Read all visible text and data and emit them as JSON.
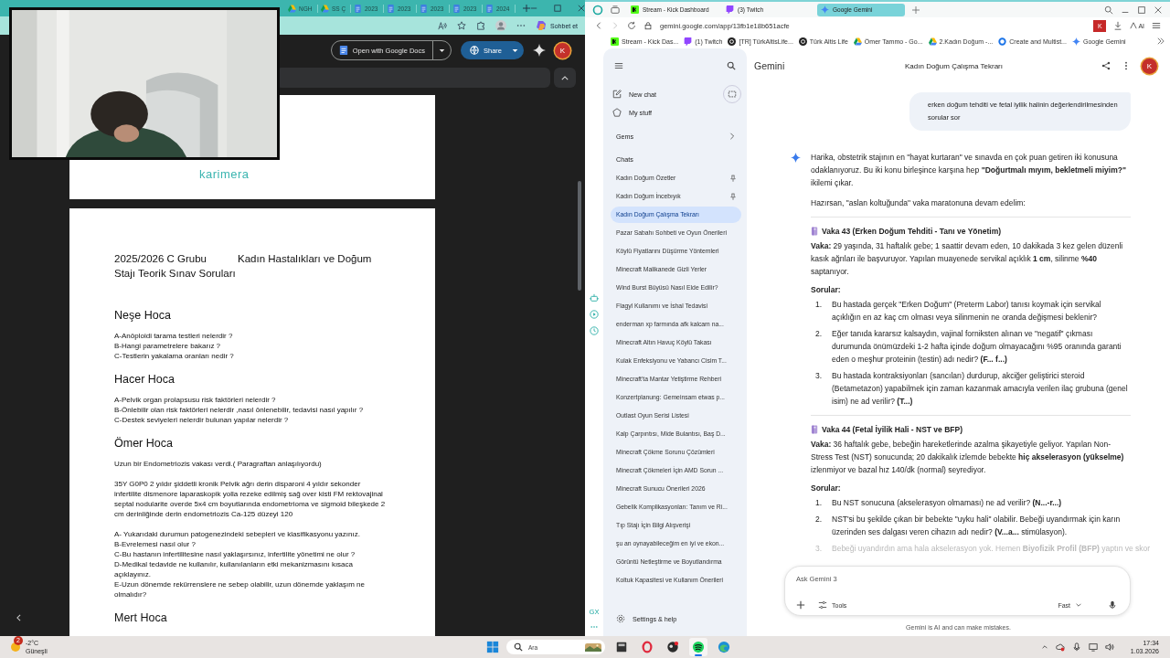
{
  "left_browser": {
    "tabs": [
      {
        "label": "NGH",
        "kind": "drive"
      },
      {
        "label": "SS Ç",
        "kind": "drive"
      },
      {
        "label": "2023",
        "kind": "doc"
      },
      {
        "label": "2023",
        "kind": "doc"
      },
      {
        "label": "2023",
        "kind": "doc"
      },
      {
        "label": "2023",
        "kind": "doc"
      },
      {
        "label": "2024",
        "kind": "doc"
      }
    ],
    "copilot": "Sohbet et"
  },
  "viewer": {
    "open_with": "Open with Google Docs",
    "share": "Share",
    "avatar": "K"
  },
  "document": {
    "cover_text": "karimera",
    "title": [
      "2025/2026 C Grubu",
      "Kadın Hastalıkları ve Doğum",
      "Stajı Teorik Sınav Soruları"
    ],
    "sections": [
      {
        "heading": "Neşe Hoca",
        "blocks": [
          [
            "A-Anöploidi tarama testleri nelerdir ?",
            "B-Hangi parametrelere bakarız ?",
            "C-Testlerin yakalama oranları nedir ?"
          ]
        ]
      },
      {
        "heading": "Hacer Hoca",
        "blocks": [
          [
            "A-Pelvik organ prolapsusu risk faktörleri nelerdir ?",
            "B-Önlebilir olan risk faktörleri nelerdir ,nasıl önlenebilir, tedavisi nasıl yapılır ?",
            "C-Destek seviyeleri nelerdir bulunan yapılar nelerdir ?"
          ]
        ]
      },
      {
        "heading": "Ömer Hoca",
        "blocks": [
          [
            "Uzun bir Endometriozis vakası verdi.( Paragraftan anlaşılıyordu)"
          ],
          [
            "35Y G0P0 2 yıldır şiddetli kronik Pelvik ağrı derin disparoni 4 yıldır sekonder infertilite dismenore laparaskopik yolla rezeke edilmiş sağ over kisti FM rektovajinal septal nodularite overde 5x4 cm boyutlarında endometrioma ve sigmoid bileşkede 2 cm derinliğinde derin endometriozis Ca-125 düzeyi 120"
          ],
          [
            "A- Yukarıdaki durumun patogenezindeki sebepleri ve klasifikasyonu yazınız.",
            "B-Evrelemesi nasıl olur ?",
            "C-Bu hastanın infertilitesine nasıl yaklaşırsınız, infertilite yönetimi ne olur ?",
            "D-Medikal tedavide ne kullanılır, kullanılanların etki mekanizmasını kısaca açıklayınız.",
            "E-Uzun dönemde rekürrenslere ne  sebep olabilir, uzun dönemde yaklaşım ne olmalıdır?"
          ]
        ]
      },
      {
        "heading": "Mert Hoca"
      }
    ]
  },
  "right_browser": {
    "tabs": [
      {
        "label": "Stream - Kick Dashboard",
        "kind": "kick",
        "selected": false
      },
      {
        "label": "(3) Twitch",
        "kind": "twitch",
        "selected": false
      },
      {
        "label": "Google Gemini",
        "kind": "gemini",
        "selected": true
      }
    ],
    "url": "gemini.google.com/app/13fb1e18b651acfe",
    "ext_avatar": "K",
    "ai_label": "AI",
    "bookmarks": [
      {
        "label": "Stream - Kick Das...",
        "kind": "kick"
      },
      {
        "label": "(1) Twitch",
        "kind": "twitch"
      },
      {
        "label": "[TR] TürkAltisLife...",
        "kind": "dark"
      },
      {
        "label": "Türk Altis Life",
        "kind": "dark"
      },
      {
        "label": "Ömer Tammo - Go...",
        "kind": "drive"
      },
      {
        "label": "2.Kadın Doğum -...",
        "kind": "drive"
      },
      {
        "label": "Create and Multist...",
        "kind": "ring"
      },
      {
        "label": "Google Gemini",
        "kind": "gemini"
      }
    ],
    "rail_label": "GX"
  },
  "gemini_sidebar": {
    "nav": [
      {
        "label": "New chat",
        "kind": "new"
      },
      {
        "label": "My stuff",
        "kind": "stuff"
      }
    ],
    "gems": "Gems",
    "chats_label": "Chats",
    "chats": [
      {
        "label": "Kadın Doğum Özetler",
        "pinned": true,
        "selected": false
      },
      {
        "label": "Kadın Doğum İncebıyık",
        "pinned": true,
        "selected": false
      },
      {
        "label": "Kadın Doğum Çalışma Tekrarı",
        "pinned": false,
        "selected": true
      },
      {
        "label": "Pazar Sabahı Sohbeti ve Oyun Önerileri",
        "pinned": false,
        "selected": false
      },
      {
        "label": "Köylü Fiyatlarını Düşürme Yöntemleri",
        "pinned": false,
        "selected": false
      },
      {
        "label": "Minecraft Malikanede Gizli Yerler",
        "pinned": false,
        "selected": false
      },
      {
        "label": "Wind Burst Büyüsü Nasıl Elde Edilir?",
        "pinned": false,
        "selected": false
      },
      {
        "label": "Flagyl Kullanımı ve İshal Tedavisi",
        "pinned": false,
        "selected": false
      },
      {
        "label": "enderman xp farmında afk kalcam na...",
        "pinned": false,
        "selected": false
      },
      {
        "label": "Minecraft Altın Havuç Köylü Takası",
        "pinned": false,
        "selected": false
      },
      {
        "label": "Kulak Enfeksiyonu ve Yabancı Cisim T...",
        "pinned": false,
        "selected": false
      },
      {
        "label": "Minecraft'ta Mantar Yetiştirme Rehberi",
        "pinned": false,
        "selected": false
      },
      {
        "label": "Konzertplanung: Gemeinsam etwas p...",
        "pinned": false,
        "selected": false
      },
      {
        "label": "Outlast Oyun Serisi Listesi",
        "pinned": false,
        "selected": false
      },
      {
        "label": "Kalp Çarpıntısı, Mide Bulantısı, Baş D...",
        "pinned": false,
        "selected": false
      },
      {
        "label": "Minecraft Çökme Sorunu Çözümleri",
        "pinned": false,
        "selected": false
      },
      {
        "label": "Minecraft Çökmeleri İçin AMD Sorun ...",
        "pinned": false,
        "selected": false
      },
      {
        "label": "Minecraft Sunucu Önerileri 2026",
        "pinned": false,
        "selected": false
      },
      {
        "label": "Gebelik Komplikasyonları: Tanım ve Ri...",
        "pinned": false,
        "selected": false
      },
      {
        "label": "Tıp Stajı İçin Bilgi Alışverişi",
        "pinned": false,
        "selected": false
      },
      {
        "label": "şu an oynayabileceğim en iyi ve ekon...",
        "pinned": false,
        "selected": false
      },
      {
        "label": "Görüntü Netleştirme ve Boyutlandırma",
        "pinned": false,
        "selected": false
      },
      {
        "label": "Koltuk Kapasitesi ve Kullanım Önerileri",
        "pinned": false,
        "selected": false
      }
    ],
    "settings": "Settings & help"
  },
  "gemini_main": {
    "brand": "Gemini",
    "title": "Kadın Doğum Çalışma Tekrarı",
    "avatar": "K",
    "user_message": "erken doğum tehditi ve fetal iyilik halinin değerlendirilmesinden sorular sor",
    "response": [
      {
        "kind": "text",
        "text": "Harika, obstetrik stajının en \"hayat kurtaran\" ve sınavda en çok puan getiren iki konusuna odaklanıyoruz. Bu iki konu birleşince karşına hep **\"Doğurtmalı mıyım, bekletmeli miyim?\"** ikilemi çıkar."
      },
      {
        "kind": "text",
        "text": "Hazırsan, \"aslan koltuğunda\" vaka maratonuna devam edelim:"
      },
      {
        "kind": "rule"
      },
      {
        "kind": "case_title",
        "text": "Vaka 43 (Erken Doğum Tehditi - Tanı ve Yönetim)"
      },
      {
        "kind": "text",
        "text": "**Vaka:** 29 yaşında, 31 haftalık gebe; 1 saattir devam eden, 10 dakikada 3 kez gelen düzenli kasık ağrıları ile başvuruyor. Yapılan muayenede servikal açıklık **1 cm**, silinme **%40** saptanıyor."
      },
      {
        "kind": "label",
        "text": "Sorular:"
      },
      {
        "kind": "list",
        "items": [
          {
            "number": "1.",
            "text": "Bu hastada gerçek \"Erken Doğum\" (Preterm Labor) tanısı koymak için servikal açıklığın en az kaç cm olması veya silinmenin ne oranda değişmesi beklenir?",
            "faded": false
          },
          {
            "number": "2.",
            "text": "Eğer tanıda kararsız kalsaydın, vajinal forniksten alınan ve \"negatif\" çıkması durumunda önümüzdeki 1-2 hafta içinde doğum olmayacağını %95 oranında garanti eden o meşhur proteinin (testin) adı nedir? **(F... f...)**",
            "faded": false
          },
          {
            "number": "3.",
            "text": "Bu hastada kontraksiyonları (sancıları) durdurup, akciğer geliştirici steroid (Betametazon) yapabilmek için zaman kazanmak amacıyla verilen ilaç grubuna (genel isim) ne ad verilir? **(T...)**",
            "faded": false
          }
        ]
      },
      {
        "kind": "rule"
      },
      {
        "kind": "case_title",
        "text": "Vaka 44 (Fetal İyilik Hali - NST ve BFP)"
      },
      {
        "kind": "text",
        "text": "**Vaka:** 36 haftalık gebe, bebeğin hareketlerinde azalma şikayetiyle geliyor. Yapılan Non-Stress Test (NST) sonucunda; 20 dakikalık izlemde bebekte **hiç akselerasyon (yükselme)** izlenmiyor ve bazal hız 140/dk (normal) seyrediyor."
      },
      {
        "kind": "label",
        "text": "Sorular:"
      },
      {
        "kind": "list",
        "items": [
          {
            "number": "1.",
            "text": "Bu NST sonucuna (akselerasyon olmaması) ne ad verilir? **(N...-r...)**",
            "faded": false
          },
          {
            "number": "2.",
            "text": "NST'si bu şekilde çıkan bir bebekte \"uyku hali\" olabilir. Bebeği uyandırmak için karın üzerinden ses dalgası veren cihazın adı nedir? **(V...a...** stimülasyon).",
            "faded": false
          },
          {
            "number": "3.",
            "text": "Bebeği uyandırdın ama hala akselerasyon yok. Hemen **Biyofizik Profil (BFP)** yaptın ve skor",
            "faded": true
          }
        ]
      }
    ],
    "input": {
      "placeholder": "Ask Gemini 3",
      "tools": "Tools",
      "mode": "Fast"
    },
    "disclaimer": "Gemini is AI and can make mistakes."
  },
  "taskbar": {
    "weather": {
      "badge": "2",
      "temp": "-2°C",
      "condition": "Güneşli"
    },
    "search_placeholder": "Ara",
    "apps": [
      {
        "kind": "explorer",
        "selected": false
      },
      {
        "kind": "opera",
        "selected": false
      },
      {
        "kind": "dark",
        "selected": false
      },
      {
        "kind": "spotify",
        "selected": true
      },
      {
        "kind": "edge",
        "selected": false
      }
    ],
    "time": "17:34",
    "date": "1.03.2026"
  }
}
